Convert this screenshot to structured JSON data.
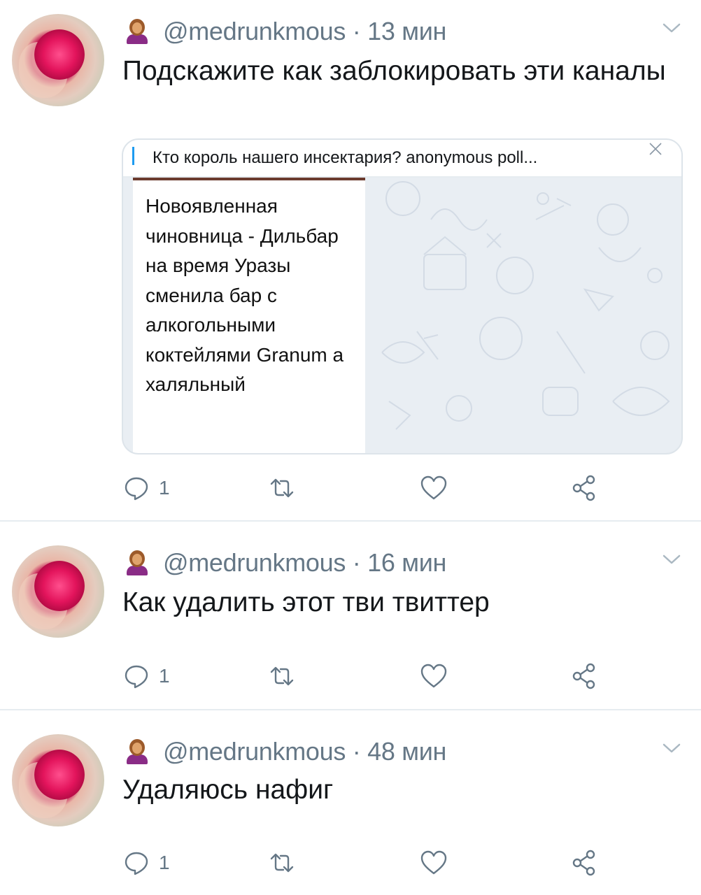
{
  "tweets": [
    {
      "emoji": "woman-tipping-hand-emoji",
      "handle": "@medrunkmous",
      "time": "· 13 мин",
      "text": "Подскажите как заблокировать эти каналы",
      "card": {
        "title": "Кто король нашего инсектария? anonymous poll...",
        "message": "Новоявленная чиновница - Дильбар на время Уразы сменила бар с алкогольными коктейлями Granum а халяльный"
      },
      "replies": "1"
    },
    {
      "emoji": "woman-tipping-hand-emoji",
      "handle": "@medrunkmous",
      "time": "· 16 мин",
      "text": "Как удалить этот тви твиттер",
      "replies": "1"
    },
    {
      "emoji": "woman-tipping-hand-emoji",
      "handle": "@medrunkmous",
      "time": "· 48 мин",
      "text": "Удаляюсь нафиг",
      "replies": "1"
    }
  ],
  "colors": {
    "text": "#14171a",
    "muted": "#657786",
    "divider": "#e6ecf0",
    "icon": "#657786"
  }
}
